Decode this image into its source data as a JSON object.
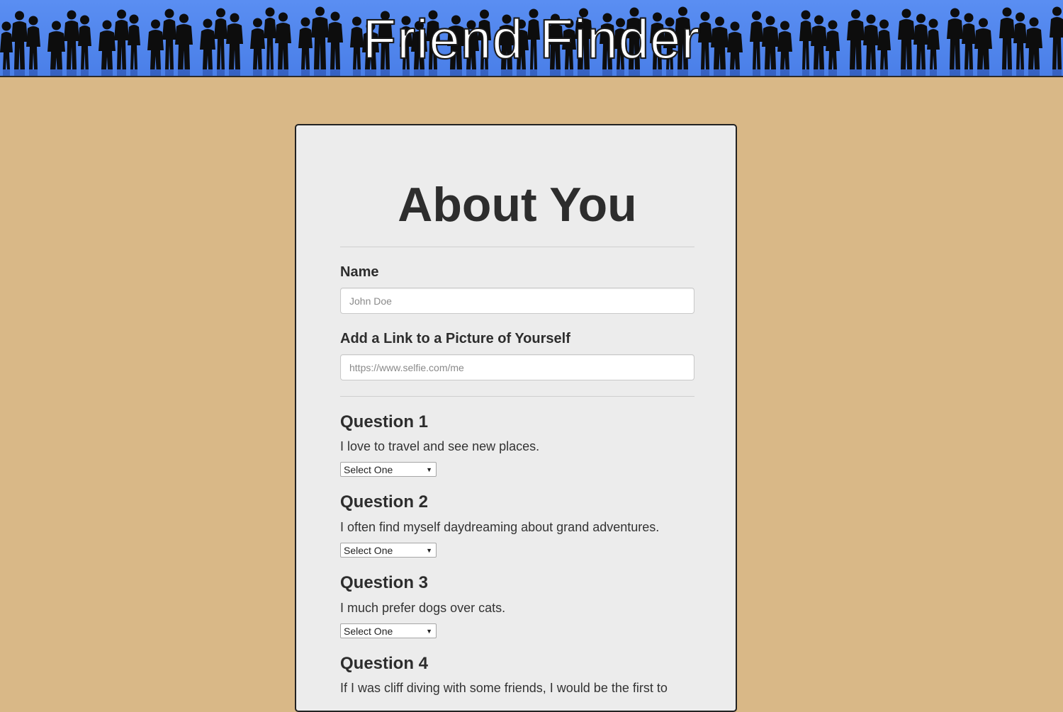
{
  "header": {
    "brand_title": "Friend Finder",
    "background_color": "#4a7fe8",
    "decoration": "crowd-silhouette-banner"
  },
  "form": {
    "title": "About You",
    "name_label": "Name",
    "name_placeholder": "John Doe",
    "name_value": "",
    "photo_label": "Add a Link to a Picture of Yourself",
    "photo_placeholder": "https://www.selfie.com/me",
    "photo_value": ""
  },
  "questions": [
    {
      "title": "Question 1",
      "text": "I love to travel and see new places.",
      "selected": "Select One"
    },
    {
      "title": "Question 2",
      "text": "I often find myself daydreaming about grand adventures.",
      "selected": "Select One"
    },
    {
      "title": "Question 3",
      "text": "I much prefer dogs over cats.",
      "selected": "Select One"
    },
    {
      "title": "Question 4",
      "text": "If I was cliff diving with some friends, I would be the first to"
    }
  ],
  "colors": {
    "page_background": "#d9b887",
    "card_background": "#ececec",
    "text": "#2d2d2d"
  }
}
